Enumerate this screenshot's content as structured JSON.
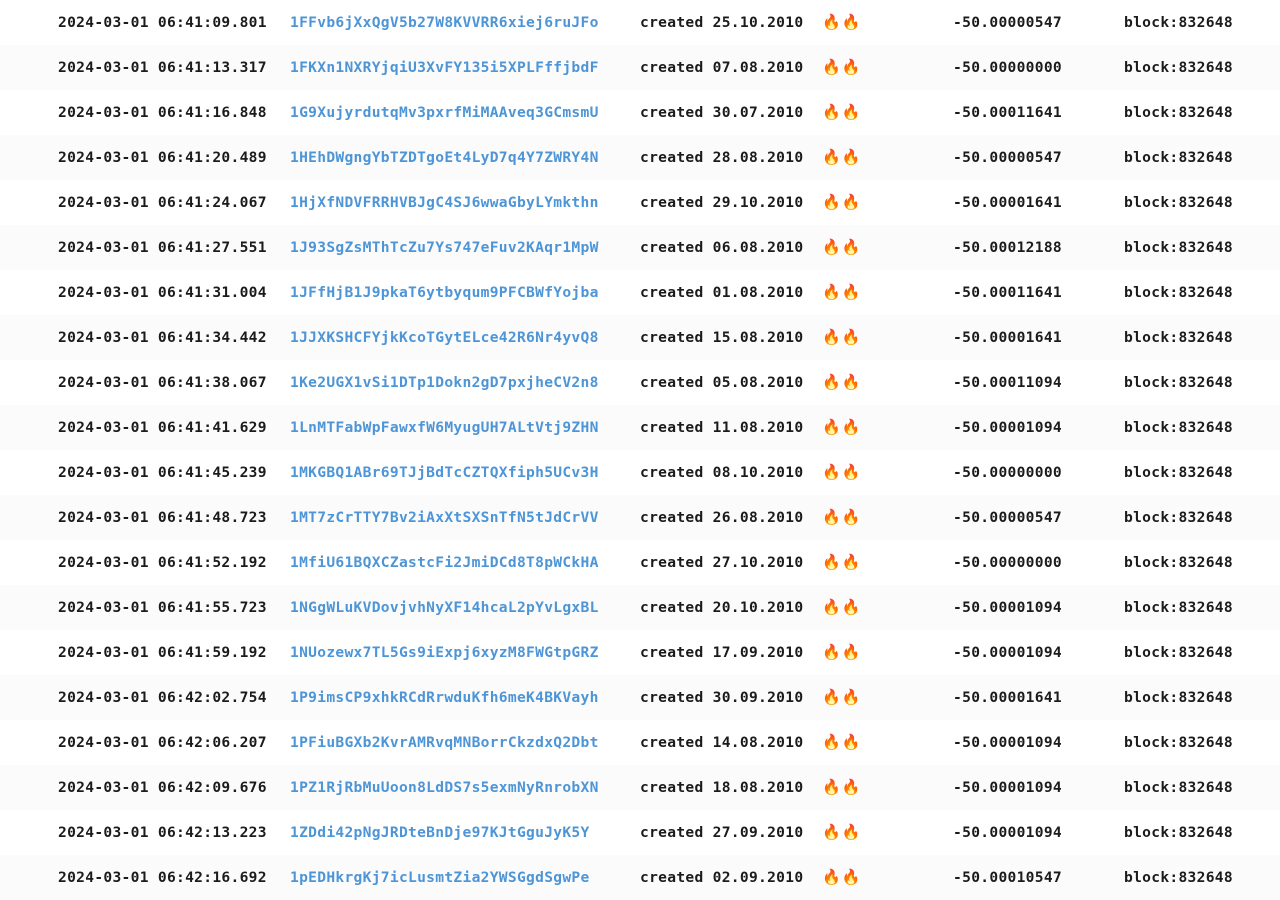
{
  "view": {
    "type": "transaction-log",
    "accent_link_color": "#4d95d6",
    "text_color": "#1b1b1b",
    "background_color": "#ffffff",
    "row_alt_background_color": "#fbfbfb",
    "fire_icon": "fire-emoji",
    "fire_icon_glyph": "🔥🔥"
  },
  "columns": {
    "timestamp": "timestamp",
    "address": "address",
    "created": "created",
    "flags": "flags",
    "amount": "amount",
    "block": "block"
  },
  "rows": [
    {
      "timestamp": "2024-03-01 06:41:09.801",
      "address": "1FFvb6jXxQgV5b27W8KVVRR6xiej6ruJFo",
      "created_label": "created",
      "created_date": "25.10.2010",
      "fire": "🔥🔥",
      "amount": "-50.00000547",
      "block": "block:832648"
    },
    {
      "timestamp": "2024-03-01 06:41:13.317",
      "address": "1FKXn1NXRYjqiU3XvFY135i5XPLFffjbdF",
      "created_label": "created",
      "created_date": "07.08.2010",
      "fire": "🔥🔥",
      "amount": "-50.00000000",
      "block": "block:832648"
    },
    {
      "timestamp": "2024-03-01 06:41:16.848",
      "address": "1G9XujyrdutqMv3pxrfMiMAAveq3GCmsmU",
      "created_label": "created",
      "created_date": "30.07.2010",
      "fire": "🔥🔥",
      "amount": "-50.00011641",
      "block": "block:832648"
    },
    {
      "timestamp": "2024-03-01 06:41:20.489",
      "address": "1HEhDWgngYbTZDTgoEt4LyD7q4Y7ZWRY4N",
      "created_label": "created",
      "created_date": "28.08.2010",
      "fire": "🔥🔥",
      "amount": "-50.00000547",
      "block": "block:832648"
    },
    {
      "timestamp": "2024-03-01 06:41:24.067",
      "address": "1HjXfNDVFRRHVBJgC4SJ6wwaGbyLYmkthn",
      "created_label": "created",
      "created_date": "29.10.2010",
      "fire": "🔥🔥",
      "amount": "-50.00001641",
      "block": "block:832648"
    },
    {
      "timestamp": "2024-03-01 06:41:27.551",
      "address": "1J93SgZsMThTcZu7Ys747eFuv2KAqr1MpW",
      "created_label": "created",
      "created_date": "06.08.2010",
      "fire": "🔥🔥",
      "amount": "-50.00012188",
      "block": "block:832648"
    },
    {
      "timestamp": "2024-03-01 06:41:31.004",
      "address": "1JFfHjB1J9pkaT6ytbyqum9PFCBWfYojba",
      "created_label": "created",
      "created_date": "01.08.2010",
      "fire": "🔥🔥",
      "amount": "-50.00011641",
      "block": "block:832648"
    },
    {
      "timestamp": "2024-03-01 06:41:34.442",
      "address": "1JJXKSHCFYjkKcoTGytELce42R6Nr4yvQ8",
      "created_label": "created",
      "created_date": "15.08.2010",
      "fire": "🔥🔥",
      "amount": "-50.00001641",
      "block": "block:832648"
    },
    {
      "timestamp": "2024-03-01 06:41:38.067",
      "address": "1Ke2UGX1vSi1DTp1Dokn2gD7pxjheCV2n8",
      "created_label": "created",
      "created_date": "05.08.2010",
      "fire": "🔥🔥",
      "amount": "-50.00011094",
      "block": "block:832648"
    },
    {
      "timestamp": "2024-03-01 06:41:41.629",
      "address": "1LnMTFabWpFawxfW6MyugUH7ALtVtj9ZHN",
      "created_label": "created",
      "created_date": "11.08.2010",
      "fire": "🔥🔥",
      "amount": "-50.00001094",
      "block": "block:832648"
    },
    {
      "timestamp": "2024-03-01 06:41:45.239",
      "address": "1MKGBQ1ABr69TJjBdTcCZTQXfiph5UCv3H",
      "created_label": "created",
      "created_date": "08.10.2010",
      "fire": "🔥🔥",
      "amount": "-50.00000000",
      "block": "block:832648"
    },
    {
      "timestamp": "2024-03-01 06:41:48.723",
      "address": "1MT7zCrTTY7Bv2iAxXtSXSnTfN5tJdCrVV",
      "created_label": "created",
      "created_date": "26.08.2010",
      "fire": "🔥🔥",
      "amount": "-50.00000547",
      "block": "block:832648"
    },
    {
      "timestamp": "2024-03-01 06:41:52.192",
      "address": "1MfiU61BQXCZastcFi2JmiDCd8T8pWCkHA",
      "created_label": "created",
      "created_date": "27.10.2010",
      "fire": "🔥🔥",
      "amount": "-50.00000000",
      "block": "block:832648"
    },
    {
      "timestamp": "2024-03-01 06:41:55.723",
      "address": "1NGgWLuKVDovjvhNyXF14hcaL2pYvLgxBL",
      "created_label": "created",
      "created_date": "20.10.2010",
      "fire": "🔥🔥",
      "amount": "-50.00001094",
      "block": "block:832648"
    },
    {
      "timestamp": "2024-03-01 06:41:59.192",
      "address": "1NUozewx7TL5Gs9iExpj6xyzM8FWGtpGRZ",
      "created_label": "created",
      "created_date": "17.09.2010",
      "fire": "🔥🔥",
      "amount": "-50.00001094",
      "block": "block:832648"
    },
    {
      "timestamp": "2024-03-01 06:42:02.754",
      "address": "1P9imsCP9xhkRCdRrwduKfh6meK4BKVayh",
      "created_label": "created",
      "created_date": "30.09.2010",
      "fire": "🔥🔥",
      "amount": "-50.00001641",
      "block": "block:832648"
    },
    {
      "timestamp": "2024-03-01 06:42:06.207",
      "address": "1PFiuBGXb2KvrAMRvqMNBorrCkzdxQ2Dbt",
      "created_label": "created",
      "created_date": "14.08.2010",
      "fire": "🔥🔥",
      "amount": "-50.00001094",
      "block": "block:832648"
    },
    {
      "timestamp": "2024-03-01 06:42:09.676",
      "address": "1PZ1RjRbMuUoon8LdDS7s5exmNyRnrobXN",
      "created_label": "created",
      "created_date": "18.08.2010",
      "fire": "🔥🔥",
      "amount": "-50.00001094",
      "block": "block:832648"
    },
    {
      "timestamp": "2024-03-01 06:42:13.223",
      "address": "1ZDdi42pNgJRDteBnDje97KJtGguJyK5Y",
      "created_label": "created",
      "created_date": "27.09.2010",
      "fire": "🔥🔥",
      "amount": "-50.00001094",
      "block": "block:832648"
    },
    {
      "timestamp": "2024-03-01 06:42:16.692",
      "address": "1pEDHkrgKj7icLusmtZia2YWSGgdSgwPe",
      "created_label": "created",
      "created_date": "02.09.2010",
      "fire": "🔥🔥",
      "amount": "-50.00010547",
      "block": "block:832648"
    }
  ]
}
